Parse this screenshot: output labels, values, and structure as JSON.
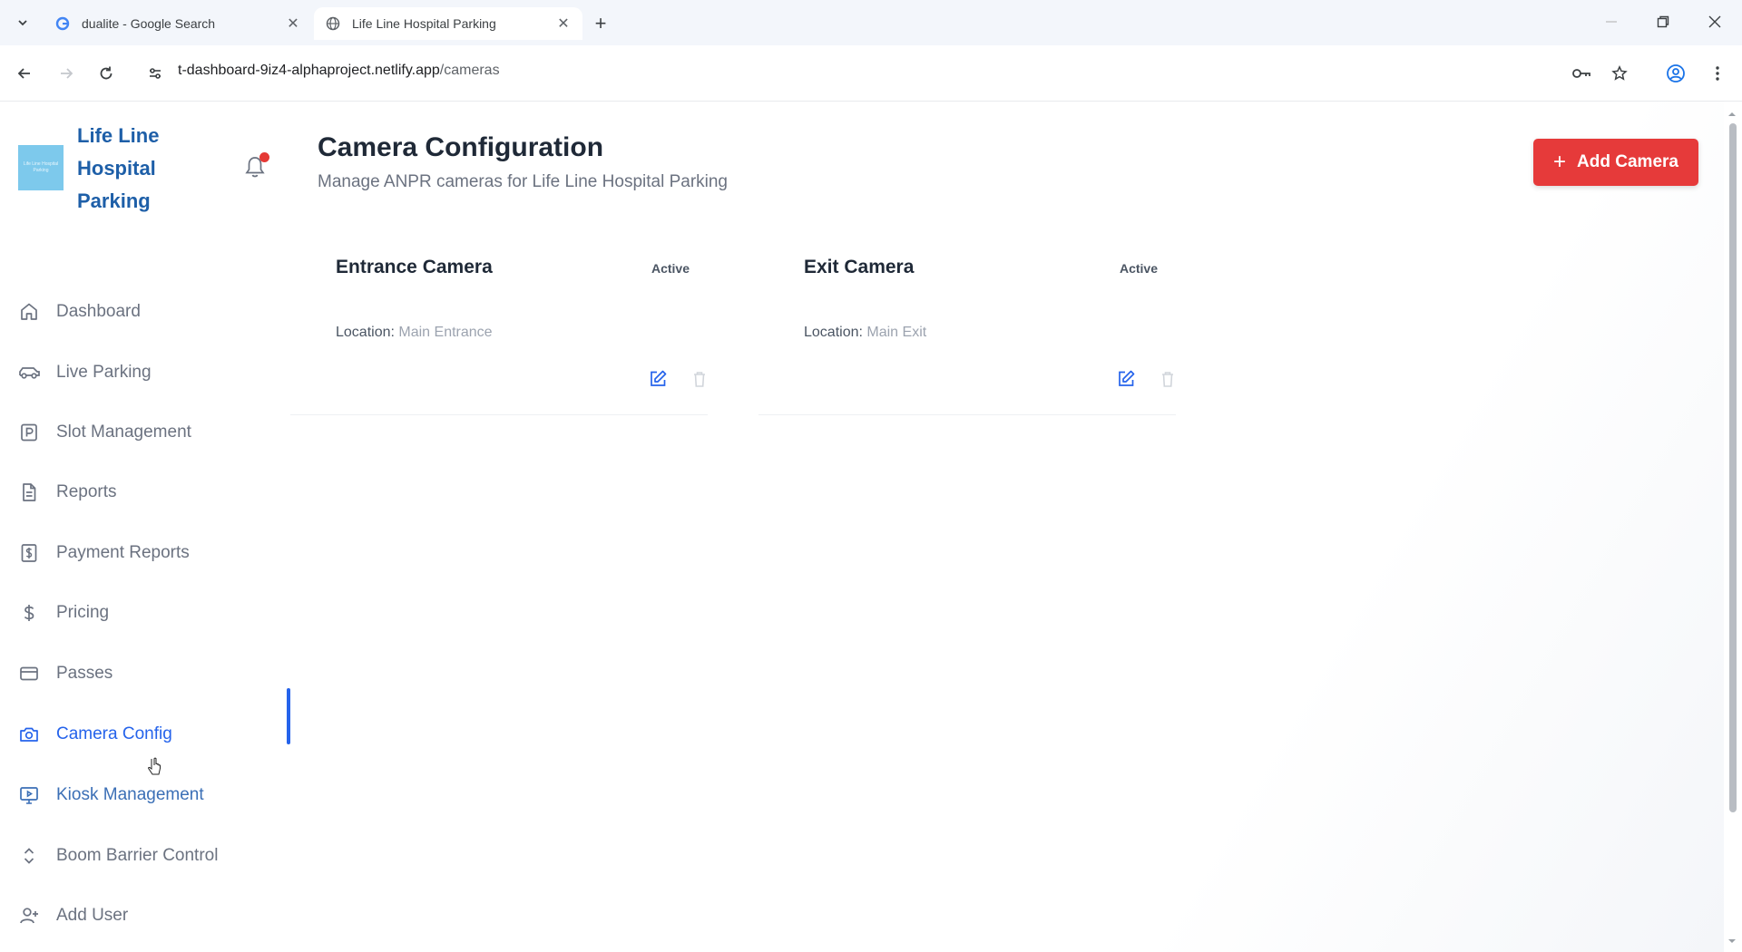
{
  "browser": {
    "tabs": [
      {
        "title": "dualite - Google Search",
        "icon": "google-icon"
      },
      {
        "title": "Life Line Hospital Parking",
        "icon": "globe-icon"
      }
    ],
    "url_host": "t-dashboard-9iz4-alphaproject.netlify.app",
    "url_path": "/cameras"
  },
  "brand": {
    "name": "Life Line Hospital Parking",
    "logo_text": "Life Line Hospital Parking"
  },
  "nav": {
    "items": [
      {
        "label": "Dashboard",
        "icon": "home-icon"
      },
      {
        "label": "Live Parking",
        "icon": "car-icon"
      },
      {
        "label": "Slot Management",
        "icon": "parking-icon"
      },
      {
        "label": "Reports",
        "icon": "document-icon"
      },
      {
        "label": "Payment Reports",
        "icon": "dollar-doc-icon"
      },
      {
        "label": "Pricing",
        "icon": "dollar-icon"
      },
      {
        "label": "Passes",
        "icon": "card-icon"
      },
      {
        "label": "Camera Config",
        "icon": "camera-icon"
      },
      {
        "label": "Kiosk Management",
        "icon": "monitor-icon"
      },
      {
        "label": "Boom Barrier Control",
        "icon": "updown-icon"
      },
      {
        "label": "Add User",
        "icon": "user-plus-icon"
      }
    ],
    "active": "Camera Config"
  },
  "page": {
    "title": "Camera Configuration",
    "subtitle": "Manage ANPR cameras for Life Line Hospital Parking",
    "add_button": "Add Camera"
  },
  "cameras": [
    {
      "name": "Entrance Camera",
      "status": "Active",
      "location_label": "Location:",
      "location": "Main Entrance"
    },
    {
      "name": "Exit Camera",
      "status": "Active",
      "location_label": "Location:",
      "location": "Main Exit"
    }
  ],
  "colors": {
    "accent": "#2563eb",
    "brand": "#1e5fa8",
    "primary_button": "#e63a3a",
    "notification_dot": "#e53935"
  }
}
